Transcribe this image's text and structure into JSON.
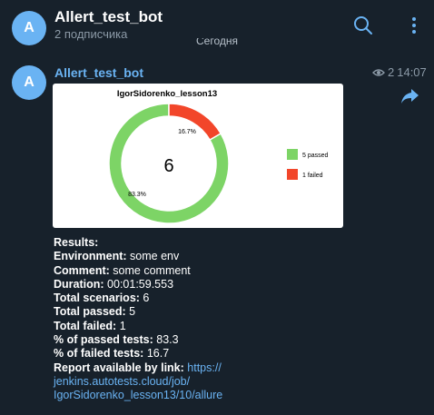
{
  "header": {
    "avatar_letter": "A",
    "title": "Allert_test_bot",
    "subtitle": "2 подписчика"
  },
  "date_separator": "Сегодня",
  "message": {
    "avatar_letter": "A",
    "sender": "Allert_test_bot",
    "views": "2",
    "time": "14:07",
    "lines": [
      {
        "label": "Results:",
        "value": ""
      },
      {
        "label": "Environment:",
        "value": "some env"
      },
      {
        "label": "Comment:",
        "value": "some comment"
      },
      {
        "label": "Duration:",
        "value": "00:01:59.553"
      },
      {
        "label": "Total scenarios:",
        "value": "6"
      },
      {
        "label": "Total passed:",
        "value": "5"
      },
      {
        "label": "Total failed:",
        "value": "1"
      },
      {
        "label": "% of passed tests:",
        "value": "83.3"
      },
      {
        "label": "% of failed tests:",
        "value": "16.7"
      }
    ],
    "report_label": "Report available by link:",
    "report_link_parts": [
      "https://",
      "jenkins.autotests.cloud/job/",
      "IgorSidorenko_lesson13/10/allure"
    ]
  },
  "colors": {
    "accent": "#6ab3f3",
    "passed": "#7dd466",
    "failed": "#f2462a"
  },
  "icons": {
    "search": "search-icon",
    "menu": "more-vertical-icon",
    "views": "eye-icon",
    "share": "share-arrow-icon"
  },
  "chart_data": {
    "type": "pie",
    "title": "IgorSidorenko_lesson13",
    "center_label": "6",
    "slices": [
      {
        "name": "5 passed",
        "value": 5,
        "percent_label": "83.3%",
        "color": "#7dd466"
      },
      {
        "name": "1 failed",
        "value": 1,
        "percent_label": "16.7%",
        "color": "#f2462a"
      }
    ],
    "legend_placement": "right"
  }
}
